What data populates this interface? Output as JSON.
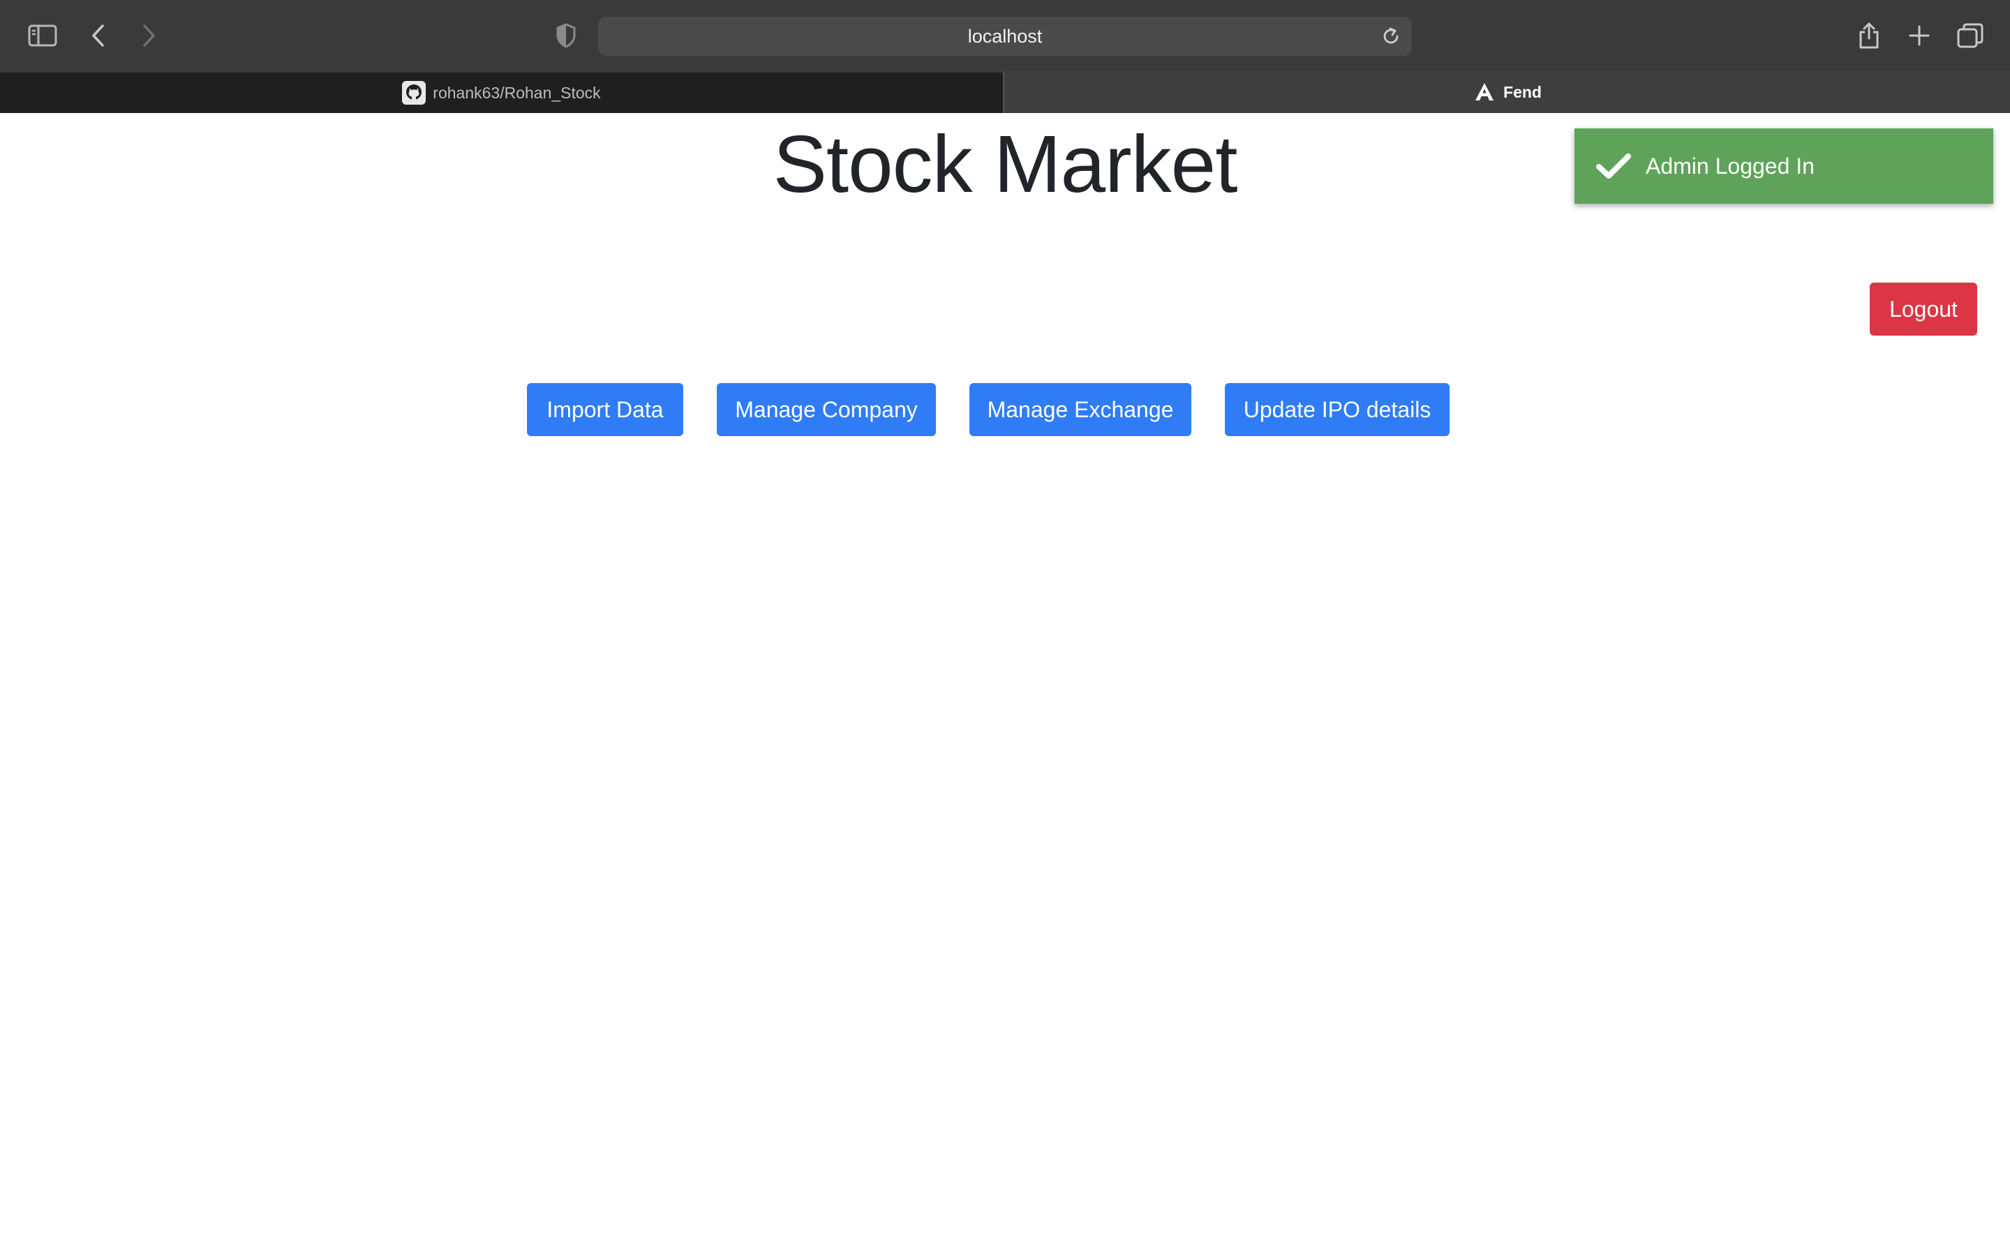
{
  "browser": {
    "address": "localhost",
    "tabs": [
      {
        "label": "rohank63/Rohan_Stock",
        "icon": "github-icon",
        "active": false
      },
      {
        "label": "Fend",
        "icon": "angular-icon",
        "active": true
      }
    ]
  },
  "page": {
    "title": "Stock Market",
    "logout_label": "Logout",
    "actions": [
      {
        "label": "Import Data"
      },
      {
        "label": "Manage Company"
      },
      {
        "label": "Manage Exchange"
      },
      {
        "label": "Update IPO details"
      }
    ]
  },
  "toast": {
    "message": "Admin Logged In",
    "icon": "checkmark-icon"
  },
  "colors": {
    "primary": "#2f7cf6",
    "danger": "#dc3545",
    "success": "#5fa35a",
    "chrome": "#3a3a3a"
  }
}
